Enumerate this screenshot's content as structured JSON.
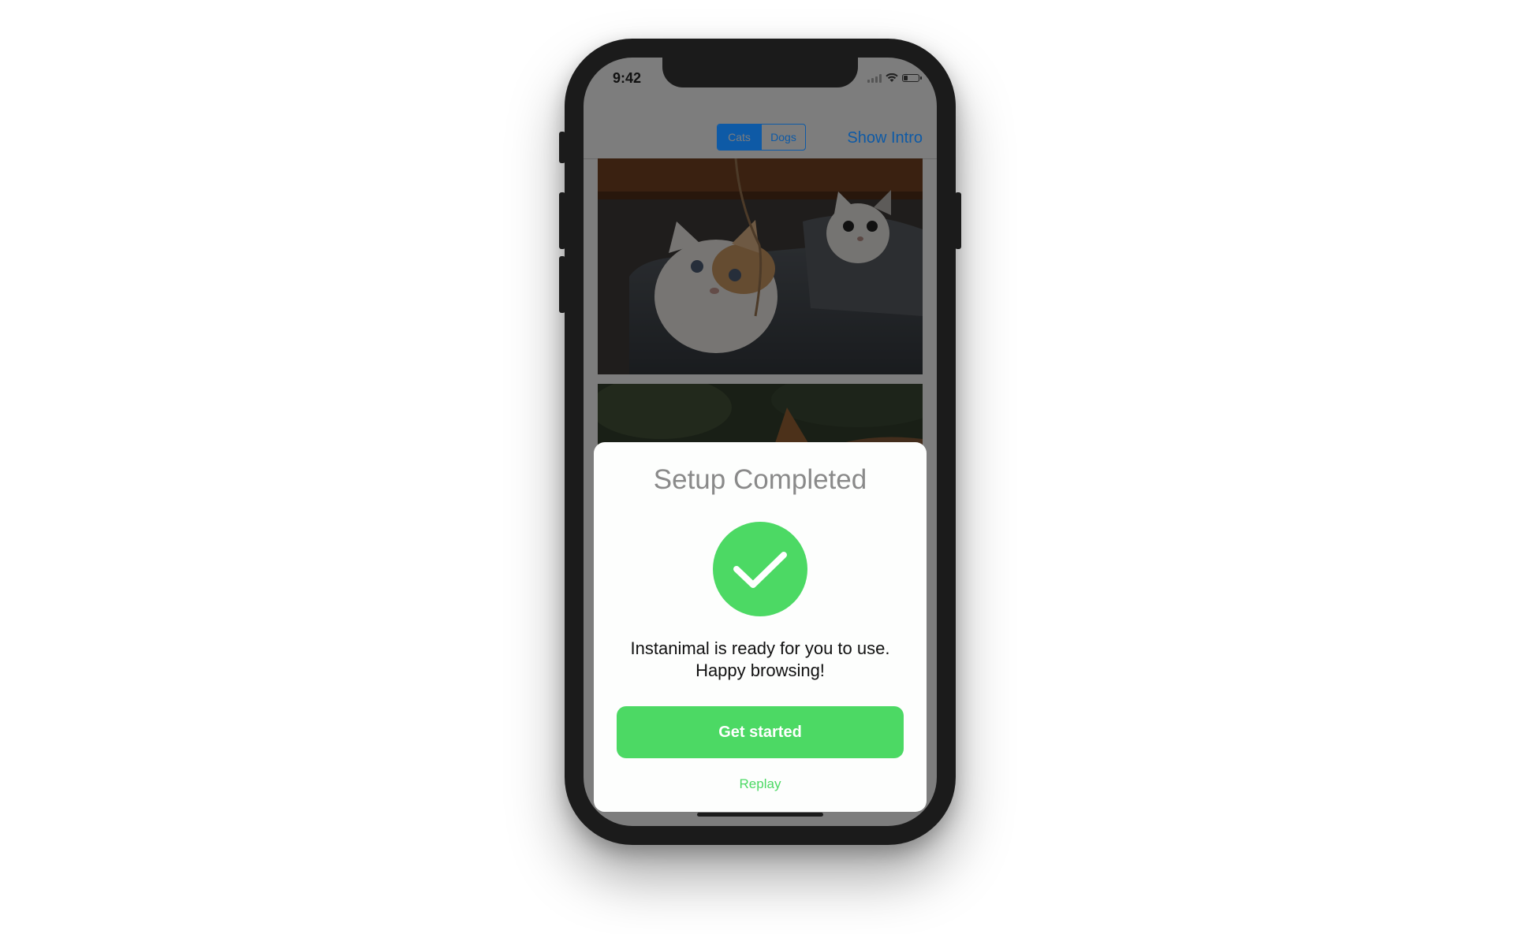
{
  "status_bar": {
    "time": "9:42",
    "icons": [
      "signal-icon",
      "wifi-icon",
      "battery-icon"
    ]
  },
  "navbar": {
    "segments": [
      {
        "label": "Cats",
        "selected": true
      },
      {
        "label": "Dogs",
        "selected": false
      }
    ],
    "right_action": "Show Intro"
  },
  "feed": {
    "items": [
      {
        "image": "kittens-in-shoe-photo"
      },
      {
        "image": "cat-in-grass-photo"
      }
    ]
  },
  "modal": {
    "title": "Setup Completed",
    "icon": "checkmark-icon",
    "message_line1": "Instanimal is ready for you to use.",
    "message_line2": "Happy browsing!",
    "primary_button": "Get started",
    "secondary_link": "Replay"
  },
  "colors": {
    "accent_green": "#4cd964",
    "nav_blue": "#0e5aa6",
    "dim_overlay": "#7d7d7d"
  }
}
